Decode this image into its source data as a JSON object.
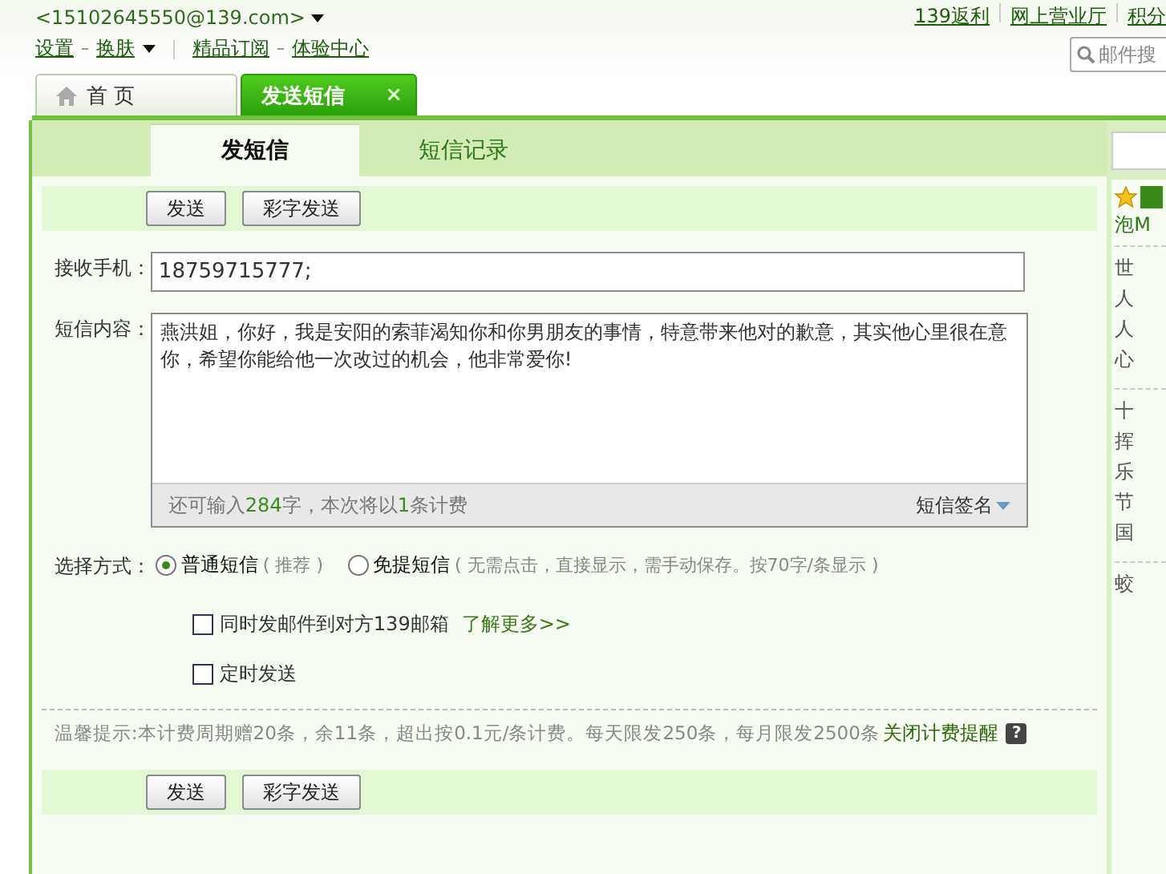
{
  "account": {
    "email": "<15102645550@139.com>"
  },
  "top_links": [
    "139返利",
    "网上营业厅",
    "积分"
  ],
  "menu": [
    {
      "label": "设置",
      "dropdown": false
    },
    {
      "label": "换肤",
      "dropdown": true
    },
    {
      "label": "精品订阅",
      "dropdown": false
    },
    {
      "label": "体验中心",
      "dropdown": false
    }
  ],
  "search": {
    "placeholder": "邮件搜"
  },
  "tabs": [
    {
      "label": "首 页",
      "selected": false,
      "closable": false
    },
    {
      "label": "发送短信",
      "selected": true,
      "closable": true
    }
  ],
  "close_glyph": "×",
  "subtabs": [
    {
      "label": "发短信",
      "selected": true
    },
    {
      "label": "短信记录",
      "selected": false
    }
  ],
  "toolbar_buttons": [
    "发送",
    "彩字发送"
  ],
  "recipient": {
    "label": "接收手机：",
    "value": "18759715777;"
  },
  "message": {
    "label": "短信内容：",
    "value": "燕洪姐，你好，我是安阳的索菲渴知你和你男朋友的事情，特意带来他对的歉意，其实他心里很在意你，希望你能给他一次改过的机会，他非常爱你!",
    "counter": [
      {
        "text": "还可输入",
        "highlight": false
      },
      {
        "text": "284",
        "highlight": true
      },
      {
        "text": "字，本次将以",
        "highlight": false
      },
      {
        "text": "1",
        "highlight": true
      },
      {
        "text": "条计费",
        "highlight": false
      }
    ],
    "signature": "短信签名"
  },
  "send_mode": {
    "label": "选择方式：",
    "options": [
      {
        "label": "普通短信",
        "note": "( 推荐 )",
        "selected": true
      },
      {
        "label": "免提短信",
        "note": "( 无需点击，直接显示，需手动保存。按70字/条显示 )",
        "selected": false
      }
    ]
  },
  "options": [
    {
      "label": "同时发邮件到对方139邮箱",
      "link": "了解更多>>",
      "checked": false
    },
    {
      "label": "定时发送",
      "checked": false
    }
  ],
  "tip": {
    "text": "温馨提示:本计费周期赠20条，余11条，超出按0.1元/条计费。每天限发250条，每月限发2500条",
    "link": "关闭计费提醒",
    "help": "?"
  },
  "bottom_buttons": [
    "发送",
    "彩字发送"
  ],
  "side_panel": {
    "header": "泡M",
    "groups": [
      [
        "世",
        "人",
        "人",
        "心"
      ],
      [
        "十",
        "挥",
        "乐",
        "节",
        "国"
      ],
      [
        "蛟"
      ]
    ]
  }
}
